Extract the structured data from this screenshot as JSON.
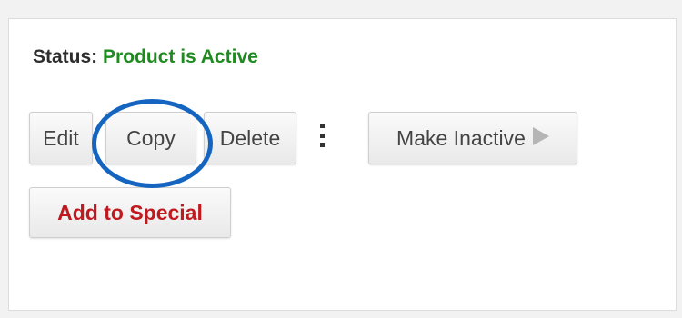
{
  "status": {
    "label": "Status:",
    "value": "Product is Active",
    "value_color": "#1f8a1f"
  },
  "actions": {
    "edit_label": "Edit",
    "copy_label": "Copy",
    "delete_label": "Delete",
    "more_icon": "kebab-menu-icon",
    "make_inactive_label": "Make Inactive",
    "make_inactive_icon": "play-triangle-icon",
    "add_to_special_label": "Add to Special",
    "add_to_special_color": "#c0191f"
  },
  "annotation": {
    "highlight_color": "#1565c0",
    "highlight_shape": "ellipse-around-copy-button"
  }
}
